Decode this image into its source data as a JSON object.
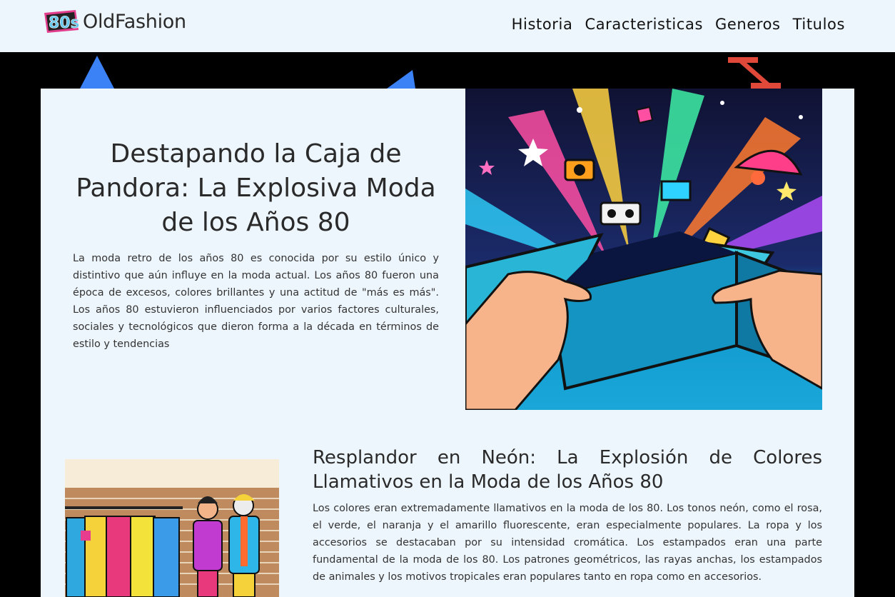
{
  "brand": {
    "logo_text": "80s",
    "name": "OldFashion"
  },
  "nav": {
    "items": [
      "Historia",
      "Caracteristicas",
      "Generos",
      "Titulos"
    ]
  },
  "hero": {
    "title": "Destapando la Caja de Pandora: La Explosiva Moda de los Años 80",
    "text": "La moda retro de los años 80 es conocida por su estilo único y distintivo que aún influye en la moda actual. Los años 80 fueron una época de excesos, colores brillantes y una actitud de \"más es más\". Los años 80 estuvieron influenciados por varios factores culturales, sociales y tecnológicos que dieron forma a la década en términos de estilo y tendencias"
  },
  "section": {
    "title": "Resplandor en Neón: La Explosión de Colores Llamativos en la Moda de los Años 80",
    "text": "Los colores eran extremadamente llamativos en la moda de los 80. Los tonos neón, como el rosa, el verde, el naranja y el amarillo fluorescente, eran especialmente populares. La ropa y los accesorios se destacaban por su intensidad cromática. Los estampados eran una parte fundamental de la moda de los 80. Los patrones geométricos, las rayas anchas, los estampados de animales y los motivos tropicales eran populares tanto en ropa como en accesorios."
  },
  "colors": {
    "navbar_bg": "#eef6fd",
    "content_bg": "#eef6fd",
    "page_bg": "#000000",
    "deco_blue": "#3b82f6",
    "deco_red": "#e0483a"
  }
}
